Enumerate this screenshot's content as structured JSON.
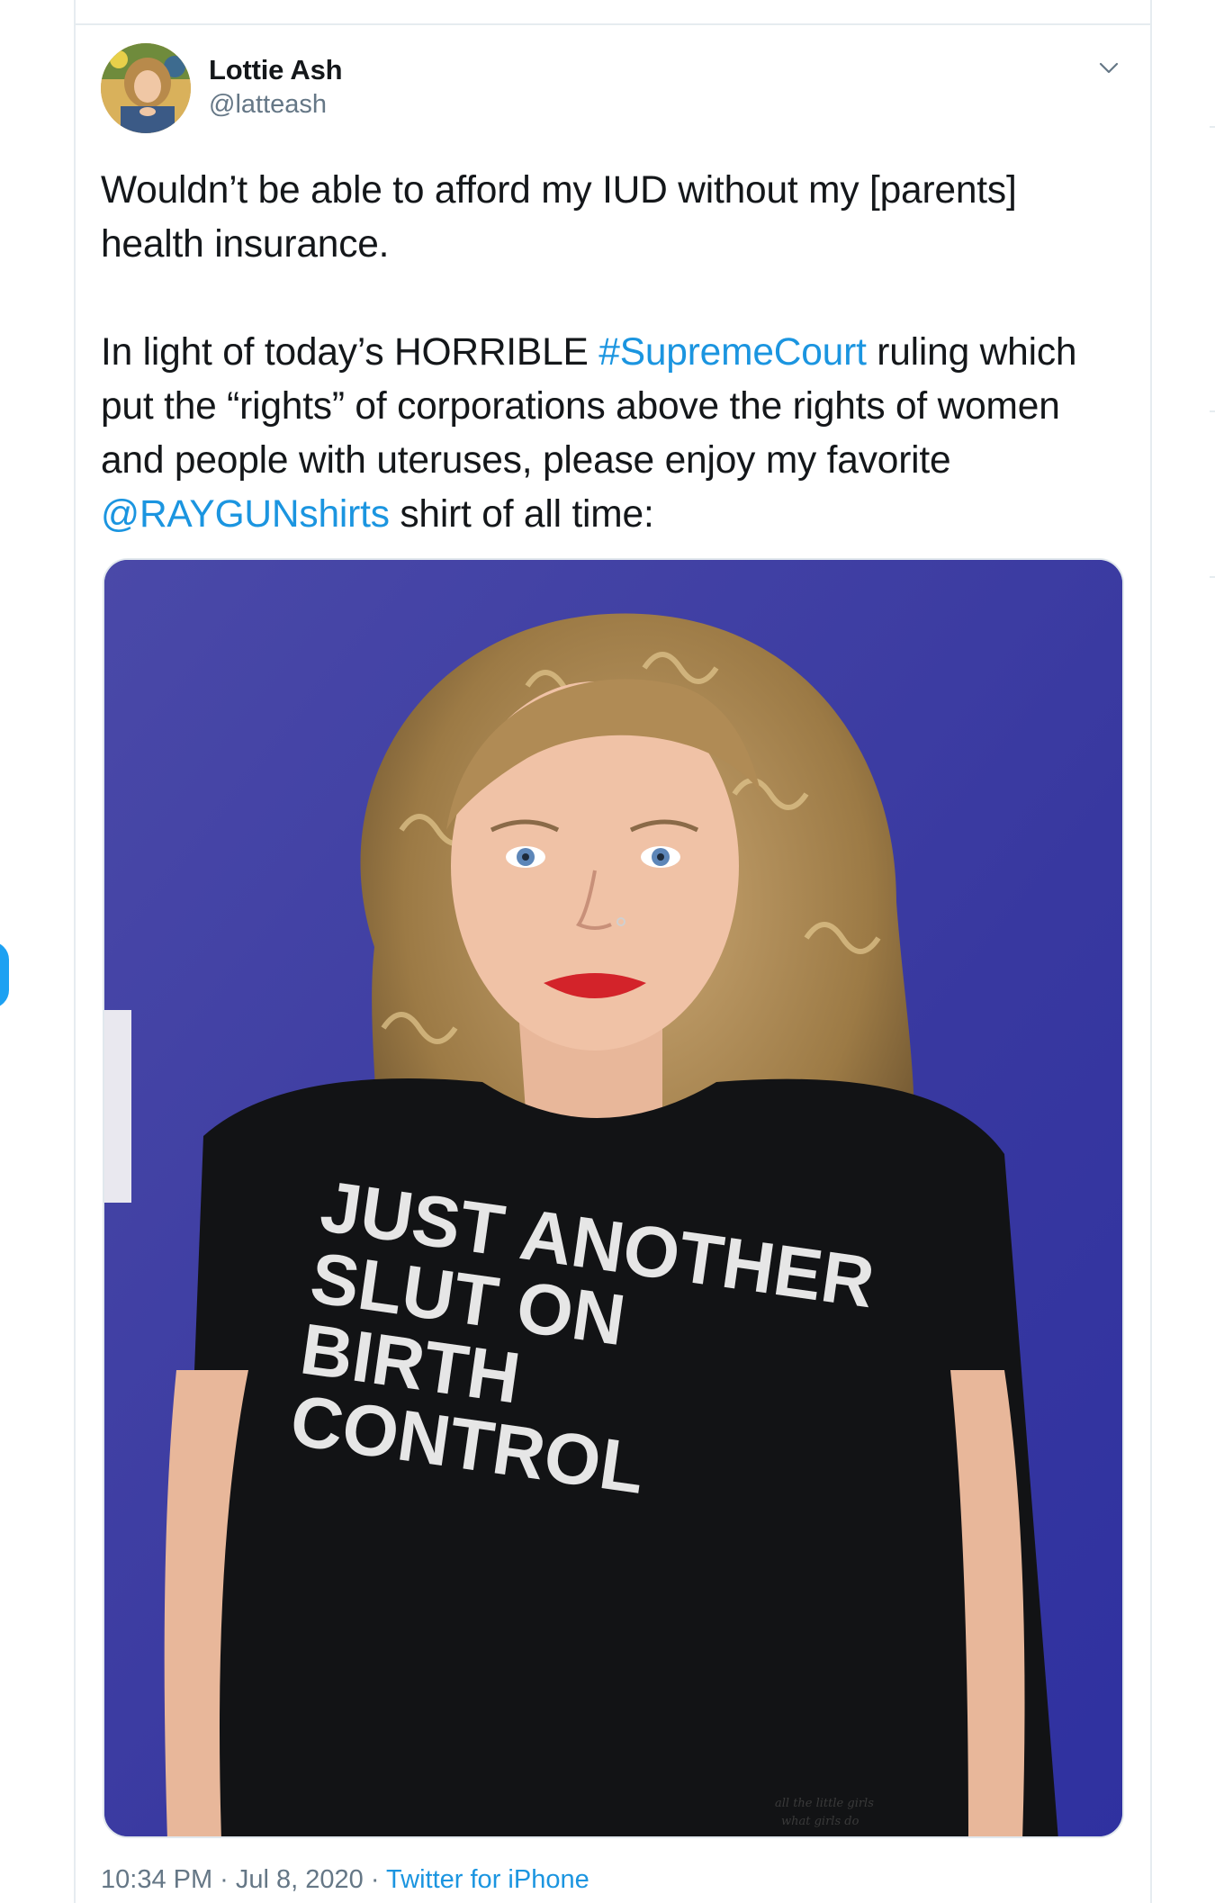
{
  "tweet": {
    "author_name": "Lottie Ash",
    "author_handle": "@latteash",
    "caret_icon": "chevron-down-icon",
    "text_line1_pre": "Wouldn’t be able to afford my IUD without my [parents] health insurance.",
    "text_p2_pre": "In light of today’s HORRIBLE ",
    "hashtag": "#SupremeCourt",
    "text_p2_mid": " ruling which put the “rights” of corporations above the rights of women and people with uteruses, please enjoy my favorite ",
    "mention": "@RAYGUNshirts",
    "text_p2_post": " shirt of all time:",
    "timestamp": "10:34 PM · Jul 8, 2020",
    "separator": " · ",
    "source": "Twitter for iPhone"
  },
  "photo": {
    "shirt_lines": [
      "JUST ANOTHER",
      "SLUT ON",
      "BIRTH",
      "CONTROL"
    ],
    "tattoo_line1": "all the little girls",
    "tattoo_line2": "what girls do"
  },
  "colors": {
    "link": "#1b95e0",
    "accent": "#1da1f2",
    "wall": "#3f3fa0",
    "lipstick": "#d3232a"
  }
}
